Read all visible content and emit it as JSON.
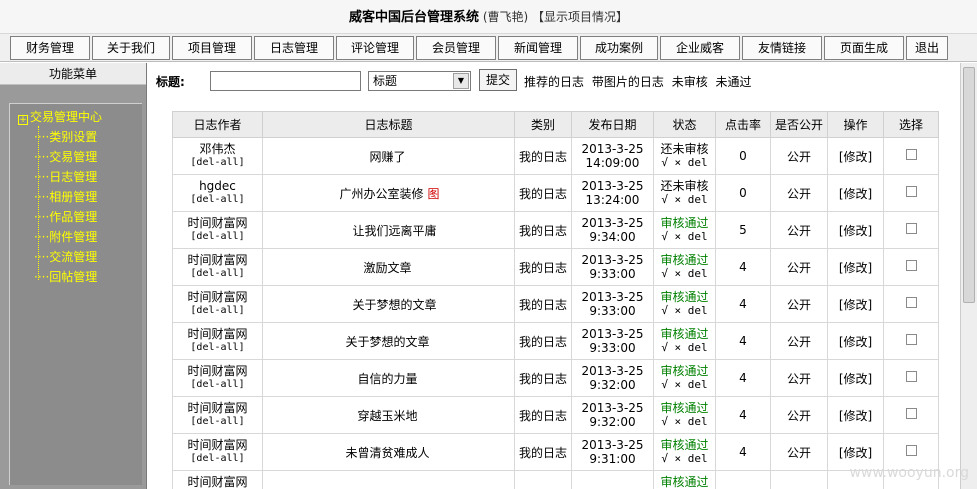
{
  "header": {
    "title": "威客中国后台管理系统",
    "user": "(曹飞艳)",
    "project_link": "【显示项目情况】"
  },
  "nav": {
    "items": [
      "财务管理",
      "关于我们",
      "项目管理",
      "日志管理",
      "评论管理",
      "会员管理",
      "新闻管理",
      "成功案例",
      "企业威客",
      "友情链接",
      "页面生成",
      "退出"
    ]
  },
  "sidebar": {
    "heading": "功能菜单",
    "root": "交易管理中心",
    "items": [
      "类别设置",
      "交易管理",
      "日志管理",
      "相册管理",
      "作品管理",
      "附件管理",
      "交流管理",
      "回帖管理"
    ]
  },
  "search": {
    "label": "标题:",
    "input_value": "",
    "select_value": "标题",
    "submit_label": "提交",
    "filters": [
      "推荐的日志",
      "带图片的日志",
      "未审核",
      "未通过"
    ]
  },
  "table": {
    "columns": [
      "日志作者",
      "日志标题",
      "类别",
      "发布日期",
      "状态",
      "点击率",
      "是否公开",
      "操作",
      "选择"
    ],
    "del_all_label": "[del-all]",
    "ops_label": "√ × del",
    "edit_label": "[修改]",
    "rows": [
      {
        "author": "邓伟杰",
        "title": "网赚了",
        "picture": "",
        "category": "我的日志",
        "date": "2013-3-25",
        "time": "14:09:00",
        "status": "还未审核",
        "clicks": "0",
        "public": "公开"
      },
      {
        "author": "hgdec",
        "title": "广州办公室装修",
        "picture": "图",
        "category": "我的日志",
        "date": "2013-3-25",
        "time": "13:24:00",
        "status": "还未审核",
        "clicks": "0",
        "public": "公开"
      },
      {
        "author": "时间财富网",
        "title": "让我们远离平庸",
        "picture": "",
        "category": "我的日志",
        "date": "2013-3-25",
        "time": "9:34:00",
        "status": "审核通过",
        "clicks": "5",
        "public": "公开"
      },
      {
        "author": "时间财富网",
        "title": "激励文章",
        "picture": "",
        "category": "我的日志",
        "date": "2013-3-25",
        "time": "9:33:00",
        "status": "审核通过",
        "clicks": "4",
        "public": "公开"
      },
      {
        "author": "时间财富网",
        "title": "关于梦想的文章",
        "picture": "",
        "category": "我的日志",
        "date": "2013-3-25",
        "time": "9:33:00",
        "status": "审核通过",
        "clicks": "4",
        "public": "公开"
      },
      {
        "author": "时间财富网",
        "title": "关于梦想的文章",
        "picture": "",
        "category": "我的日志",
        "date": "2013-3-25",
        "time": "9:33:00",
        "status": "审核通过",
        "clicks": "4",
        "public": "公开"
      },
      {
        "author": "时间财富网",
        "title": "自信的力量",
        "picture": "",
        "category": "我的日志",
        "date": "2013-3-25",
        "time": "9:32:00",
        "status": "审核通过",
        "clicks": "4",
        "public": "公开"
      },
      {
        "author": "时间财富网",
        "title": "穿越玉米地",
        "picture": "",
        "category": "我的日志",
        "date": "2013-3-25",
        "time": "9:32:00",
        "status": "审核通过",
        "clicks": "4",
        "public": "公开"
      },
      {
        "author": "时间财富网",
        "title": "未曾清贫难成人",
        "picture": "",
        "category": "我的日志",
        "date": "2013-3-25",
        "time": "9:31:00",
        "status": "审核通过",
        "clicks": "4",
        "public": "公开"
      },
      {
        "author": "时间财富网",
        "title": "",
        "picture": "",
        "category": "",
        "date": "",
        "time": "",
        "status": "审核通过",
        "clicks": "",
        "public": ""
      }
    ]
  },
  "watermark": "www.wooyun.org",
  "colors": {
    "tree_text": "#ffff00",
    "approved": "#008000",
    "picture_tag": "#d00000"
  }
}
